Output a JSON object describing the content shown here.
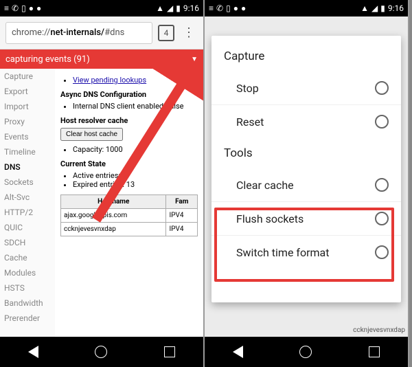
{
  "status": {
    "time": "9:16"
  },
  "url": {
    "prefix": "chrome://",
    "bold": "net-internals/",
    "suffix": "#dns"
  },
  "tabs": "4",
  "banner": "capturing events (91)",
  "sidebar": {
    "items": [
      "Capture",
      "Export",
      "Import",
      "Proxy",
      "Events",
      "Timeline",
      "DNS",
      "Sockets",
      "Alt-Svc",
      "HTTP/2",
      "QUIC",
      "SDCH",
      "Cache",
      "Modules",
      "HSTS",
      "Bandwidth",
      "Prerender"
    ],
    "activeIndex": 6
  },
  "main": {
    "link": "View pending lookups",
    "h1": "Async DNS Configuration",
    "li1": "Internal DNS client enabled: false",
    "h2": "Host resolver cache",
    "btn": "Clear host cache",
    "li2": "Capacity: 1000",
    "h3": "Current State",
    "li3": "Active entries: 0",
    "li4": "Expired entries: 13",
    "th1": "Hostname",
    "th2": "Fam",
    "td1a": "ajax.googleapis.com",
    "td1b": "IPV4",
    "td2a": "ccknjevesvnxdap",
    "td2b": "IPV4"
  },
  "menu": {
    "capture": "Capture",
    "stop": "Stop",
    "reset": "Reset",
    "tools": "Tools",
    "clear": "Clear cache",
    "flush": "Flush sockets",
    "switch": "Switch time format"
  },
  "ghost": {
    "cell": "ccknjevesvnxdap"
  }
}
